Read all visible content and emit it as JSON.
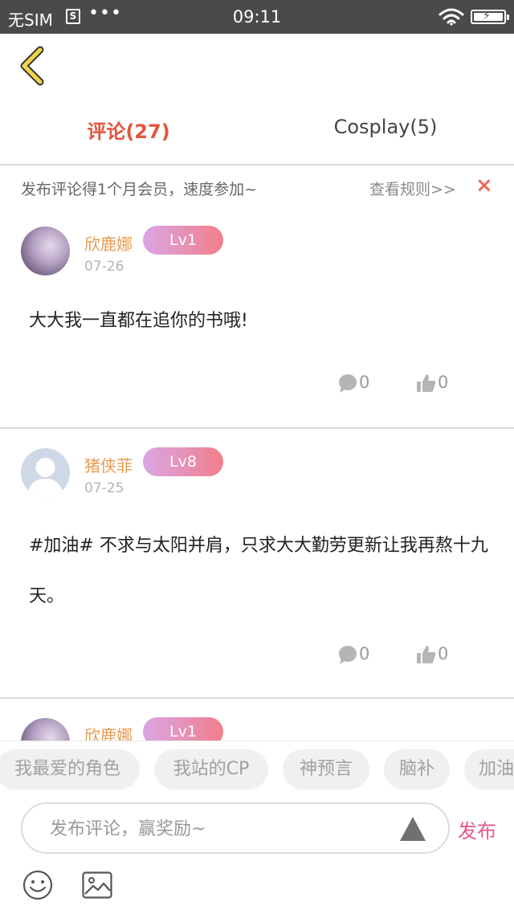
{
  "status_bar": {
    "carrier": "无SIM",
    "sim_icon": "S",
    "dots": "•••",
    "time": "09:11"
  },
  "tabs": [
    {
      "label": "评论(27)",
      "active": true
    },
    {
      "label": "Cosplay(5)",
      "active": false
    }
  ],
  "notice": {
    "text": "发布评论得1个月会员，速度参加~",
    "rules_link": "查看规则>>",
    "close": "×"
  },
  "comments": [
    {
      "user": "欣鹿娜",
      "level": "Lv1",
      "date": "07-26",
      "text": "大大我一直都在追你的书哦!",
      "replies": "0",
      "likes": "0"
    },
    {
      "user": "猪侠菲",
      "level": "Lv8",
      "date": "07-25",
      "text": "#加油# 不求与太阳并肩，只求大大勤劳更新让我再熬十九天。",
      "replies": "0",
      "likes": "0"
    },
    {
      "user": "欣鹿娜",
      "level": "Lv1"
    }
  ],
  "chips": [
    "我最爱的角色",
    "我站的CP",
    "神预言",
    "脑补",
    "加油"
  ],
  "input": {
    "placeholder": "发布评论，赢奖励~",
    "value": ""
  },
  "publish_label": "发布",
  "colors": {
    "accent_tab": "#e2553d",
    "username": "#e99a4f",
    "publish": "#e35a8c",
    "close": "#ee6a5c",
    "back_arrow": "#f1d54a",
    "level_gradient_start": "#d9a6e4",
    "level_gradient_end": "#f27f8b"
  },
  "icons": {
    "back": "chevron-left-icon",
    "reply": "comment-bubble-icon",
    "like": "thumbs-up-icon",
    "send": "triangle-send-icon",
    "emoji": "smiley-icon",
    "image": "image-icon",
    "wifi": "wifi-icon",
    "battery": "battery-charging-icon"
  }
}
